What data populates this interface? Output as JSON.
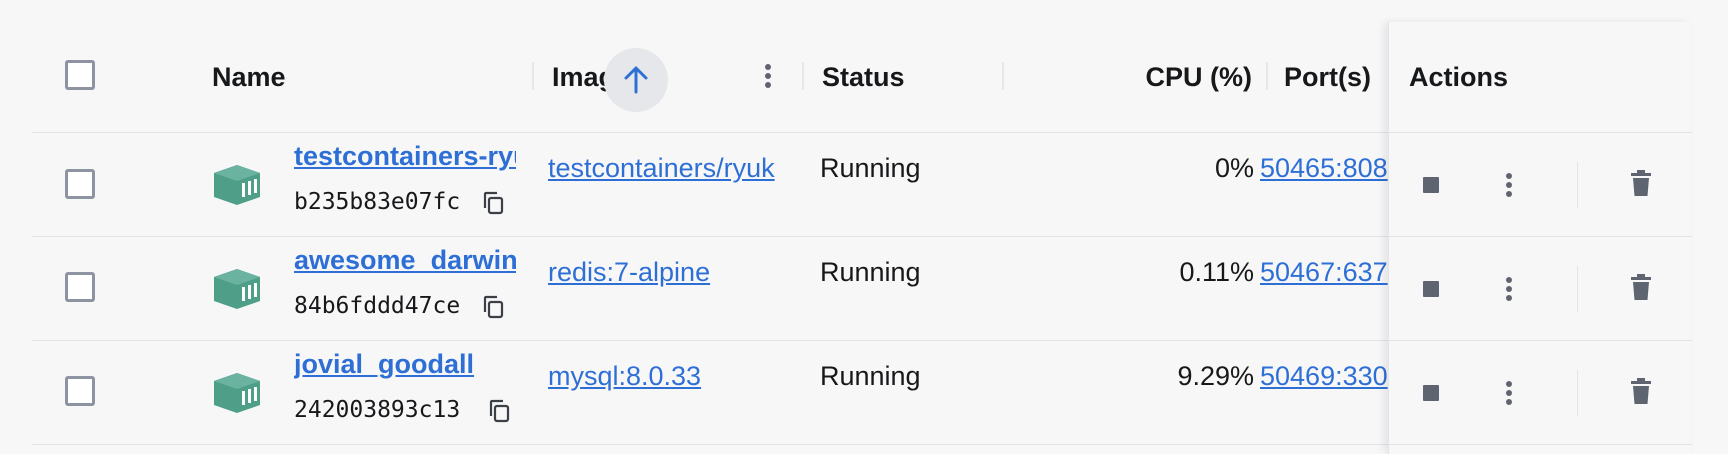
{
  "header": {
    "name": "Name",
    "image": "Image",
    "status": "Status",
    "cpu": "CPU (%)",
    "ports": "Port(s)",
    "actions": "Actions"
  },
  "colors": {
    "link": "#2e6fd6",
    "container_icon": "#4e9e88",
    "action_icon": "#5f6570"
  },
  "icons": {
    "sort": "arrow-up-icon",
    "column_menu": "kebab-menu-icon",
    "container": "container-icon",
    "copy": "copy-icon",
    "stop": "stop-icon",
    "more": "kebab-menu-icon",
    "delete": "trash-icon"
  },
  "rows": [
    {
      "name": "testcontainers-ryu",
      "id": "b235b83e07fc",
      "image": "testcontainers/ryuk",
      "status": "Running",
      "cpu": "0%",
      "ports": "50465:808"
    },
    {
      "name": "awesome_darwin",
      "id": "84b6fddd47ce",
      "image": "redis:7-alpine",
      "status": "Running",
      "cpu": "0.11%",
      "ports": "50467:637"
    },
    {
      "name": "jovial_goodall",
      "id": "242003893c13",
      "image": "mysql:8.0.33",
      "status": "Running",
      "cpu": "9.29%",
      "ports": "50469:330"
    }
  ]
}
